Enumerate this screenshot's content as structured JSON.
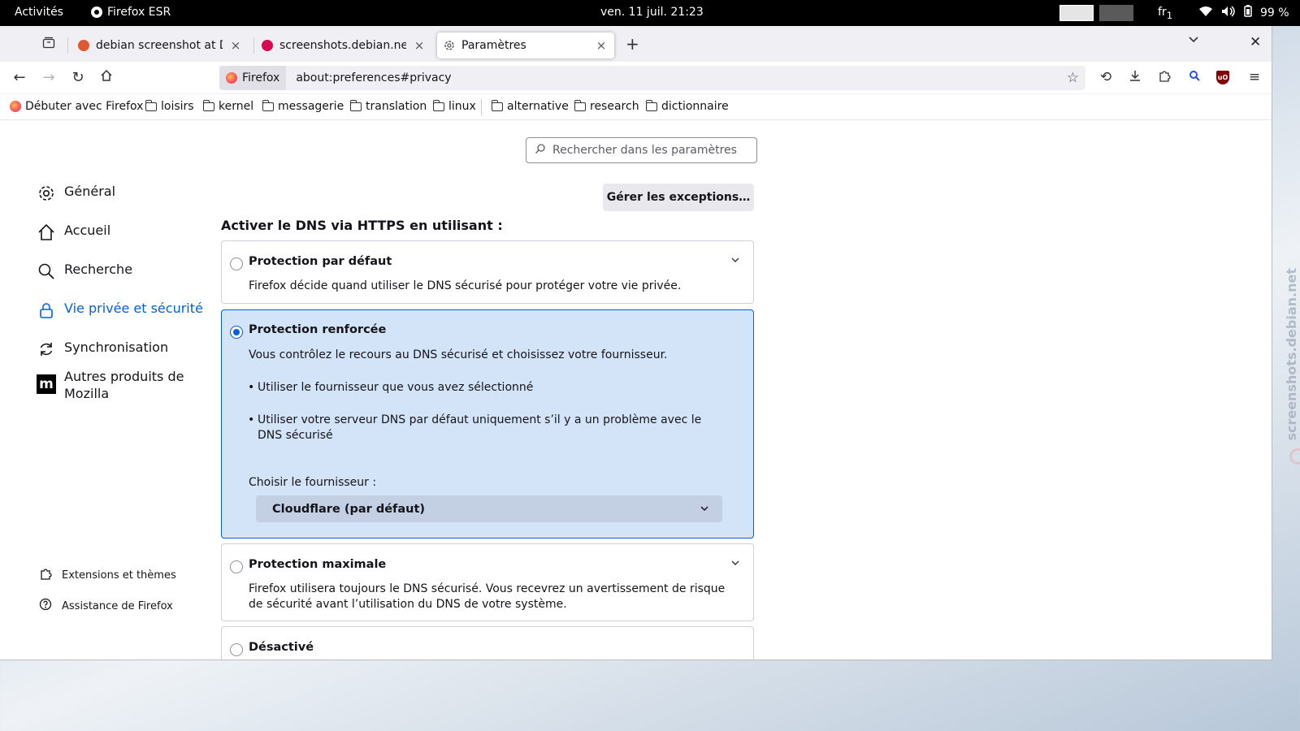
{
  "topbar": {
    "activities": "Activités",
    "app_name": "Firefox ESR",
    "clock": "ven. 11 juil.  21:23",
    "lang": "fr",
    "battery": "99 %"
  },
  "tabs": [
    {
      "title": "debian screenshot at DuckDuckGo",
      "favicon_color": "#de5833"
    },
    {
      "title": "screenshots.debian.net",
      "favicon_color": "#d70751"
    },
    {
      "title": "Paramètres",
      "favicon_color": "#5b5b66"
    }
  ],
  "urlbar": {
    "identity_label": "Firefox",
    "url": "about:preferences#privacy"
  },
  "bookmarks": [
    {
      "label": "Débuter avec Firefox",
      "icon": "firefox-icon"
    },
    {
      "label": "loisirs",
      "icon": "folder-icon"
    },
    {
      "label": "kernel",
      "icon": "folder-icon"
    },
    {
      "label": "messagerie",
      "icon": "folder-icon"
    },
    {
      "label": "translation",
      "icon": "folder-icon"
    },
    {
      "label": "linux",
      "icon": "folder-icon"
    },
    {
      "label": "alternative",
      "icon": "folder-icon"
    },
    {
      "label": "research",
      "icon": "folder-icon"
    },
    {
      "label": "dictionnaire",
      "icon": "folder-icon"
    }
  ],
  "search": {
    "placeholder": "Rechercher dans les paramètres"
  },
  "sidebar": {
    "items": [
      {
        "label": "Général",
        "icon": "gear-icon"
      },
      {
        "label": "Accueil",
        "icon": "home-icon"
      },
      {
        "label": "Recherche",
        "icon": "search-icon"
      },
      {
        "label": "Vie privée et sécurité",
        "icon": "lock-icon",
        "selected": true
      },
      {
        "label": "Synchronisation",
        "icon": "sync-icon"
      },
      {
        "label": "Autres produits de Mozilla",
        "icon": "mozilla-icon"
      }
    ],
    "footer": [
      {
        "label": "Extensions et thèmes",
        "icon": "puzzle-icon"
      },
      {
        "label": "Assistance de Firefox",
        "icon": "help-icon"
      }
    ]
  },
  "main": {
    "manage_exceptions": "Gérer les exceptions…",
    "section_title": "Activer le DNS via HTTPS en utilisant :",
    "options": {
      "default": {
        "title": "Protection par défaut",
        "desc": "Firefox décide quand utiliser le DNS sécurisé pour protéger votre vie privée."
      },
      "increased": {
        "title": "Protection renforcée",
        "desc": "Vous contrôlez le recours au DNS sécurisé et choisissez votre fournisseur.",
        "bullets": [
          "Utiliser le fournisseur que vous avez sélectionné",
          "Utiliser votre serveur DNS par défaut uniquement s’il y a un problème avec le DNS sécurisé"
        ],
        "provider_label": "Choisir le fournisseur :",
        "provider_value": "Cloudflare (par défaut)"
      },
      "max": {
        "title": "Protection maximale",
        "desc": "Firefox utilisera toujours le DNS sécurisé. Vous recevrez un avertissement de risque de sécurité avant l’utilisation du DNS de votre système."
      },
      "off": {
        "title": "Désactivé"
      }
    },
    "selected_option": "increased"
  },
  "watermark": "screenshots.debian.net",
  "colors": {
    "accent": "#0061e0",
    "selected_card_bg": "#d3e3f8"
  }
}
